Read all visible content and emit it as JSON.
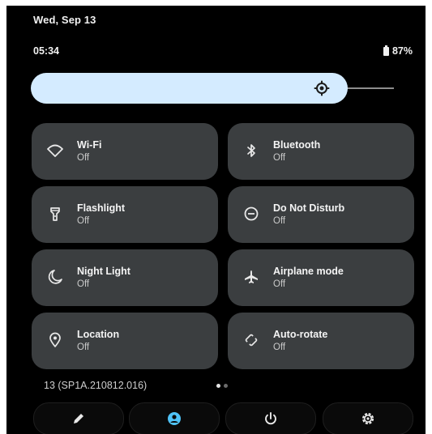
{
  "status": {
    "date": "Wed, Sep 13",
    "time": "05:34",
    "battery": "87%",
    "battery_icon": "battery-icon"
  },
  "brightness": {
    "icon": "brightness-icon",
    "level_fraction": 0.82
  },
  "tiles": [
    {
      "label": "Wi-Fi",
      "state": "Off",
      "icon": "wifi-icon"
    },
    {
      "label": "Bluetooth",
      "state": "Off",
      "icon": "bluetooth-icon"
    },
    {
      "label": "Flashlight",
      "state": "Off",
      "icon": "flashlight-icon"
    },
    {
      "label": "Do Not Disturb",
      "state": "Off",
      "icon": "do-not-disturb-icon"
    },
    {
      "label": "Night Light",
      "state": "Off",
      "icon": "night-light-icon"
    },
    {
      "label": "Airplane mode",
      "state": "Off",
      "icon": "airplane-icon"
    },
    {
      "label": "Location",
      "state": "Off",
      "icon": "location-icon"
    },
    {
      "label": "Auto-rotate",
      "state": "Off",
      "icon": "auto-rotate-icon"
    }
  ],
  "footer": {
    "build": "13 (SP1A.210812.016)",
    "page_current": 1,
    "page_count": 2
  },
  "bottom_bar": [
    {
      "icon": "edit-icon"
    },
    {
      "icon": "user-icon",
      "accent": "#4fc3f7"
    },
    {
      "icon": "power-icon"
    },
    {
      "icon": "settings-icon"
    }
  ],
  "colors": {
    "background": "#000000",
    "tile": "#3b3e40",
    "brightness": "#d4ebff",
    "accent": "#4fc3f7"
  }
}
